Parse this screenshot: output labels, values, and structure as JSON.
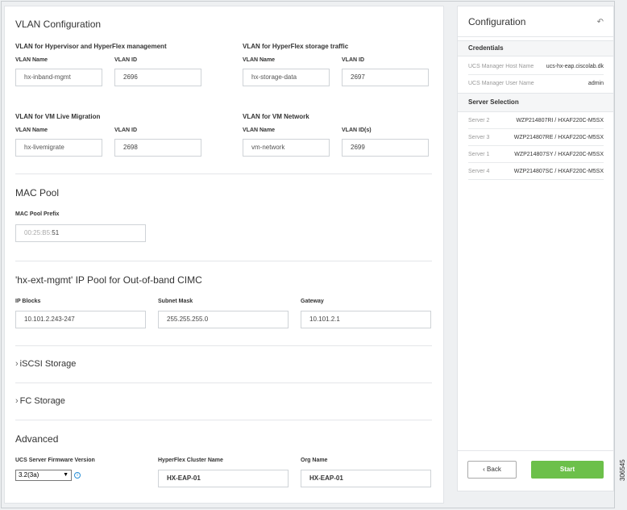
{
  "main": {
    "vlan_title": "VLAN Configuration",
    "vlan_groups": [
      {
        "title": "VLAN for Hypervisor and HyperFlex management",
        "name_label": "VLAN Name",
        "id_label": "VLAN ID",
        "name_value": "hx-inband-mgmt",
        "id_value": "2696"
      },
      {
        "title": "VLAN for HyperFlex storage traffic",
        "name_label": "VLAN Name",
        "id_label": "VLAN ID",
        "name_value": "hx-storage-data",
        "id_value": "2697"
      },
      {
        "title": "VLAN for VM Live Migration",
        "name_label": "VLAN Name",
        "id_label": "VLAN ID",
        "name_value": "hx-livemigrate",
        "id_value": "2698"
      },
      {
        "title": "VLAN for VM Network",
        "name_label": "VLAN Name",
        "id_label": "VLAN ID(s)",
        "name_value": "vm-network",
        "id_value": "2699"
      }
    ],
    "mac_title": "MAC Pool",
    "mac_label": "MAC Pool Prefix",
    "mac_prefix_fixed": "00:25:B5:",
    "mac_prefix_value": "51",
    "ip_title": "'hx-ext-mgmt' IP Pool for Out-of-band CIMC",
    "ip_blocks_label": "IP Blocks",
    "ip_blocks_value": "10.101.2.243-247",
    "subnet_label": "Subnet Mask",
    "subnet_value": "255.255.255.0",
    "gateway_label": "Gateway",
    "gateway_value": "10.101.2.1",
    "iscsi_label": "iSCSI Storage",
    "fc_label": "FC Storage",
    "advanced_title": "Advanced",
    "firmware_label": "UCS Server Firmware Version",
    "firmware_value": "3.2(3a)",
    "cluster_name_label": "HyperFlex Cluster Name",
    "cluster_name_value": "HX-EAP-01",
    "org_name_label": "Org Name",
    "org_name_value": "HX-EAP-01"
  },
  "side": {
    "title": "Configuration",
    "credentials_label": "Credentials",
    "credentials": [
      {
        "key": "UCS Manager Host Name",
        "value": "ucs-hx-eap.ciscolab.dk"
      },
      {
        "key": "UCS Manager User Name",
        "value": "admin"
      }
    ],
    "server_selection_label": "Server Selection",
    "servers": [
      {
        "key": "Server 2",
        "value": "WZP214807RI / HXAF220C-M5SX"
      },
      {
        "key": "Server 3",
        "value": "WZP214807RE / HXAF220C-M5SX"
      },
      {
        "key": "Server 1",
        "value": "WZP214807SY / HXAF220C-M5SX"
      },
      {
        "key": "Server 4",
        "value": "WZP214807SC / HXAF220C-M5SX"
      }
    ],
    "back_label": "Back",
    "start_label": "Start"
  },
  "figure_id": "306545",
  "icons": {
    "back_arrow": "undo-arrow-icon",
    "chevron": "chevron-right-icon",
    "info": "info-icon"
  },
  "colors": {
    "start_button": "#6cc04a",
    "info": "#2a8fd6"
  }
}
